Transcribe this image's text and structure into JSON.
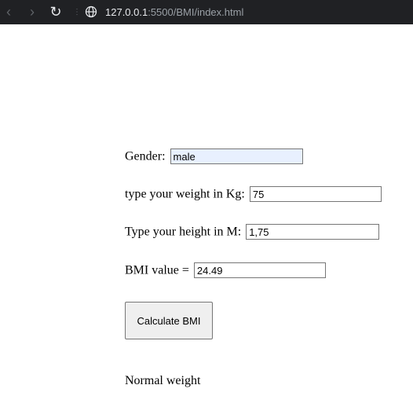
{
  "browser": {
    "url_host": "127.0.0.1",
    "url_rest": ":5500/BMI/index.html",
    "back_icon": "‹",
    "forward_icon": "›",
    "reload_icon": "↻"
  },
  "form": {
    "gender_label": "Gender:",
    "gender_value": "male",
    "weight_label": "type your weight in Kg:",
    "weight_value": "75",
    "height_label": "Type your height in M:",
    "height_value": "1,75",
    "bmi_label": "BMI value =",
    "bmi_value": "24.49",
    "calculate_label": "Calculate BMI",
    "result_text": "Normal weight"
  },
  "colors": {
    "toolbar_bg": "#202124",
    "autofill_bg": "#e8f0fe"
  }
}
